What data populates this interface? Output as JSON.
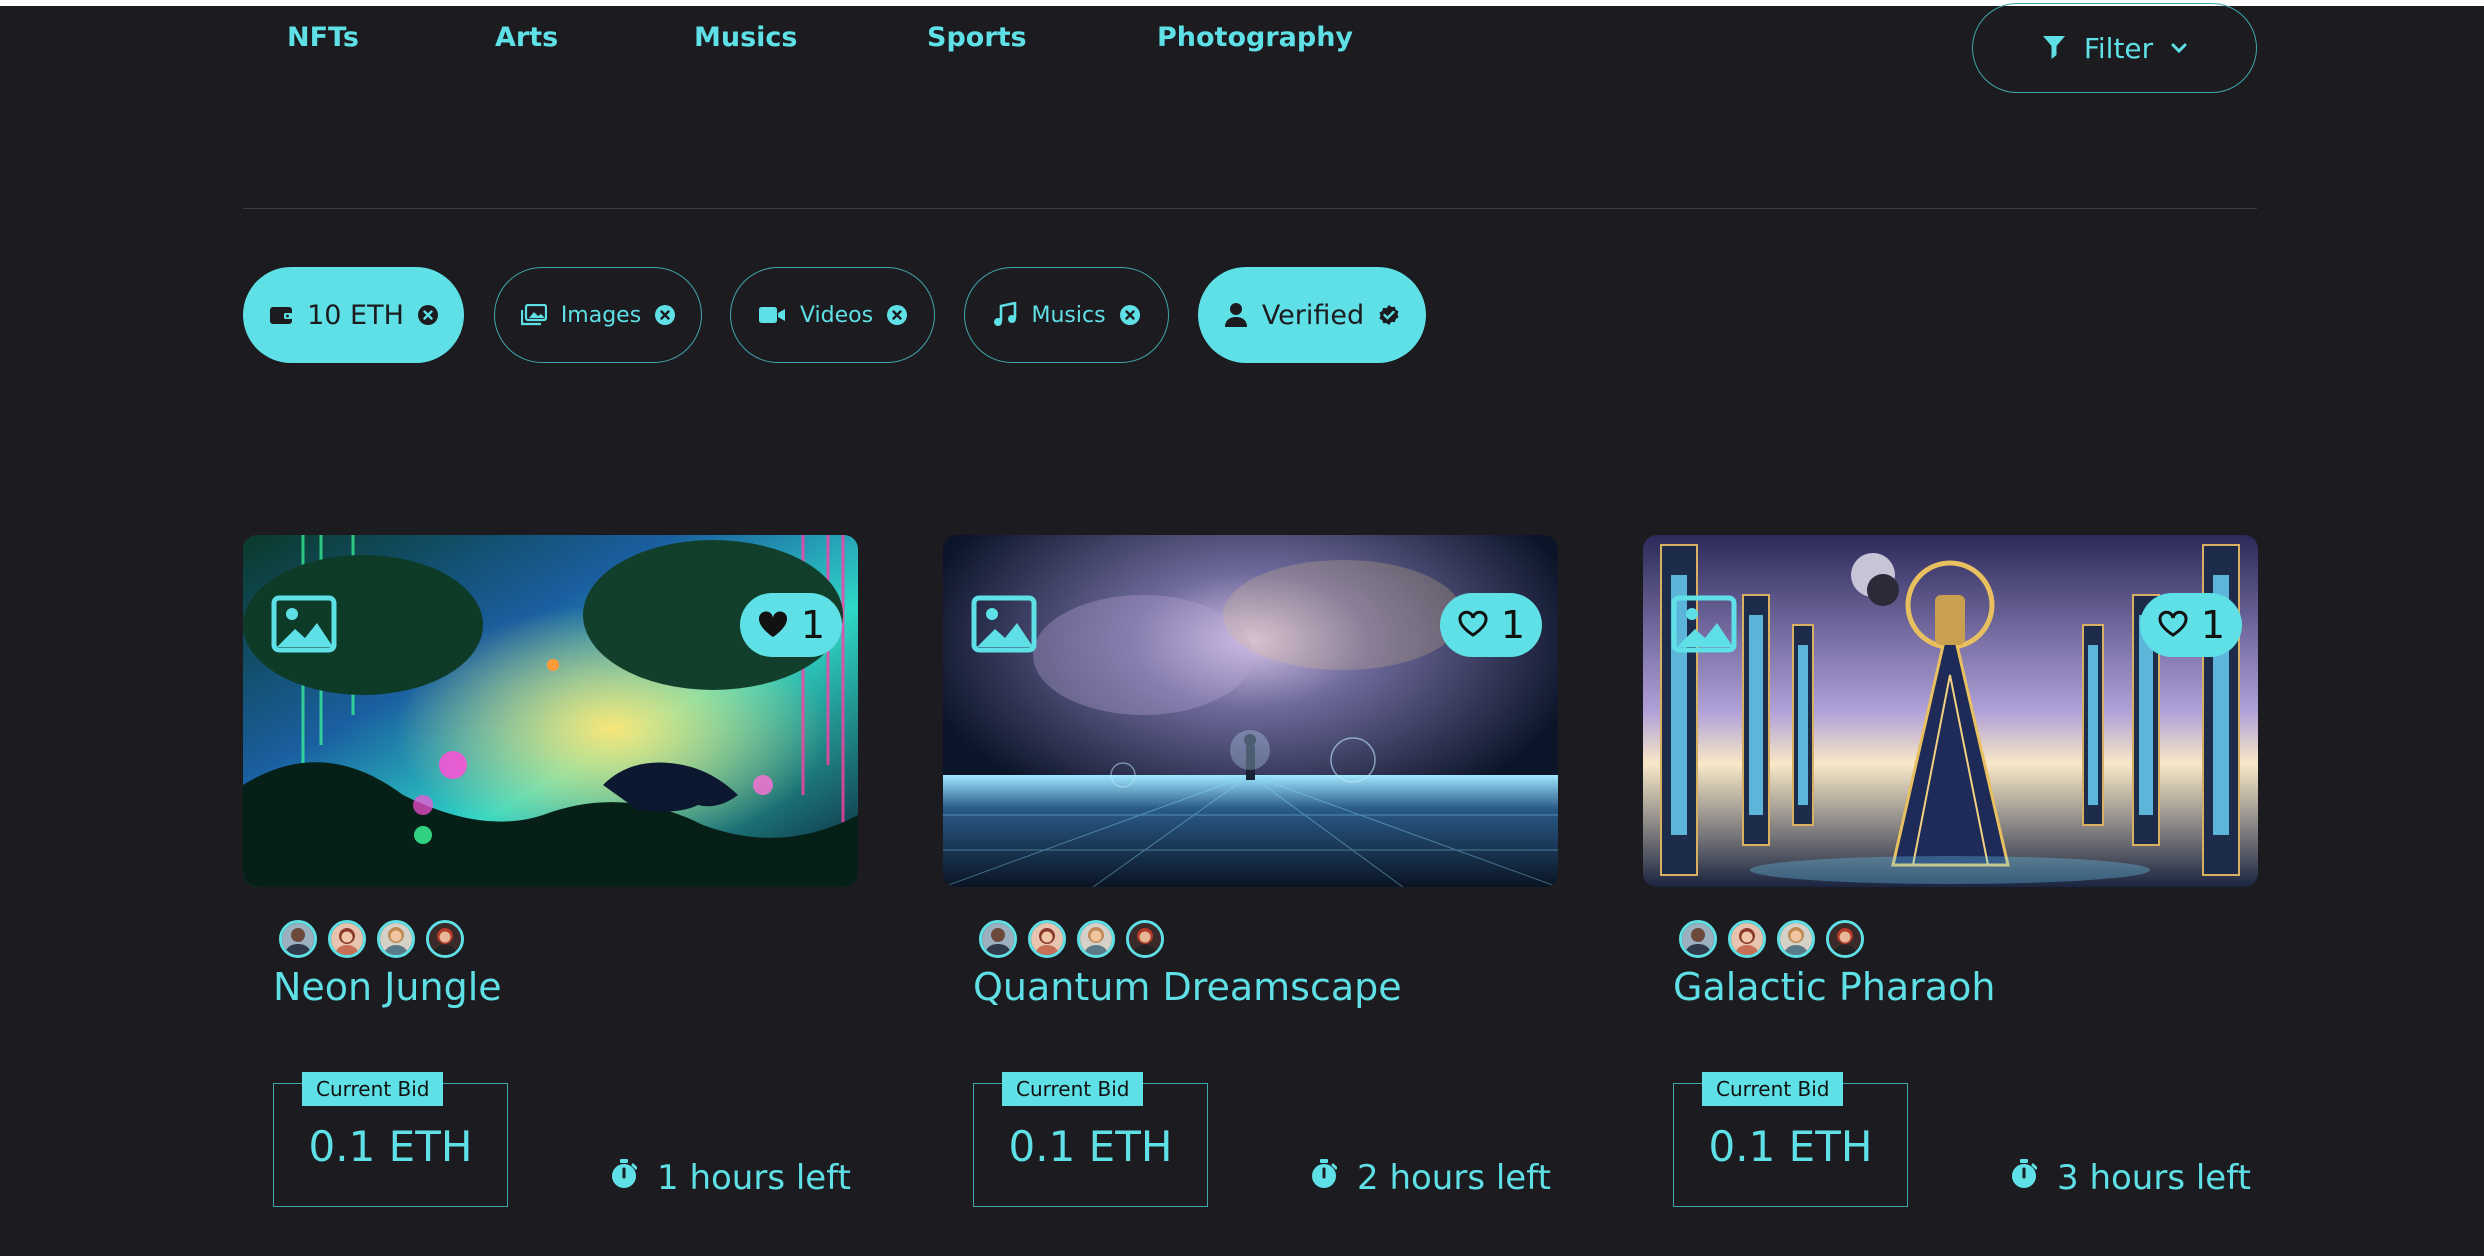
{
  "nav": {
    "items": [
      "NFTs",
      "Arts",
      "Musics",
      "Sports",
      "Photography"
    ]
  },
  "filter": {
    "label": "Filter",
    "icon": "funnel-icon"
  },
  "chips": [
    {
      "label": "10 ETH",
      "icon": "wallet-icon",
      "state": "active"
    },
    {
      "label": "Images",
      "icon": "images-icon",
      "state": "inactive"
    },
    {
      "label": "Videos",
      "icon": "video-icon",
      "state": "inactive"
    },
    {
      "label": "Musics",
      "icon": "music-note-icon",
      "state": "inactive"
    },
    {
      "label": "Verified",
      "icon": "user-icon",
      "state": "active"
    }
  ],
  "cards": [
    {
      "title": "Neon Jungle",
      "likes": "1",
      "liked": true,
      "bid_label": "Current Bid",
      "bid_value": "0.1 ETH",
      "time_left": "1 hours left"
    },
    {
      "title": "Quantum Dreamscape",
      "likes": "1",
      "liked": false,
      "bid_label": "Current Bid",
      "bid_value": "0.1 ETH",
      "time_left": "2 hours left"
    },
    {
      "title": "Galactic Pharaoh",
      "likes": "1",
      "liked": false,
      "bid_label": "Current Bid",
      "bid_value": "0.1 ETH",
      "time_left": "3 hours left"
    }
  ],
  "colors": {
    "accent": "#5ee0e6",
    "background": "#1c1b1f",
    "outline": "#3fa6ab"
  }
}
